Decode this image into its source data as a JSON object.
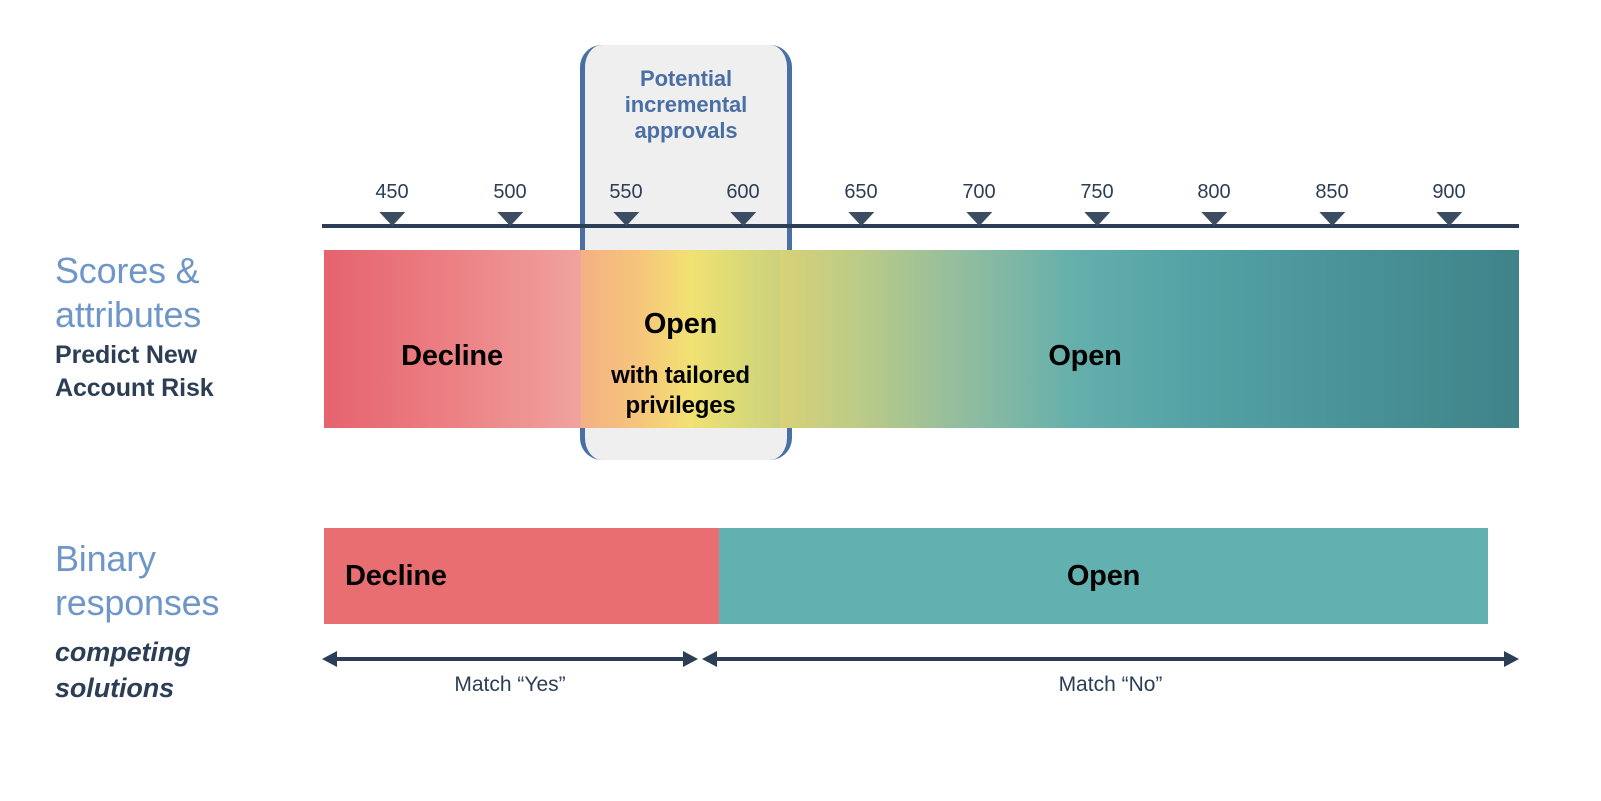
{
  "chart_data": {
    "type": "bar",
    "title": "",
    "xlabel": "",
    "ylabel": "",
    "axis": {
      "ticks": [
        450,
        500,
        550,
        600,
        650,
        700,
        750,
        800,
        850,
        900
      ],
      "tick_labels": [
        "450",
        "500",
        "550",
        "600",
        "650",
        "700",
        "750",
        "800",
        "850",
        "900"
      ],
      "range_min": 430,
      "range_max": 925,
      "grid": false
    },
    "series": [
      {
        "name": "Scores & attributes",
        "type": "gradient-band",
        "segments": [
          {
            "label": "Decline",
            "sublabel": "",
            "from": 430,
            "to": 550,
            "color_start": "#E5636E",
            "color_end": "#F0A39F"
          },
          {
            "label": "Open",
            "sublabel": "with tailored privileges",
            "from": 550,
            "to": 600,
            "color_start": "#F4B183",
            "color_end": "#D6D178"
          },
          {
            "label": "Open",
            "sublabel": "",
            "from": 600,
            "to": 925,
            "color_start": "#D6D178",
            "color_end": "#3F8389"
          }
        ]
      },
      {
        "name": "Binary responses",
        "type": "band",
        "segments": [
          {
            "label": "Decline",
            "from": 430,
            "to": 585,
            "color": "#E86E72"
          },
          {
            "label": "Open",
            "from": 585,
            "to": 925,
            "color": "#63B0B0"
          }
        ]
      }
    ],
    "annotations": [
      {
        "text": "Potential incremental approvals",
        "from": 550,
        "to": 600
      },
      {
        "text": "Match “Yes”",
        "from": 430,
        "to": 585
      },
      {
        "text": "Match “No”",
        "from": 585,
        "to": 925
      }
    ]
  },
  "rows": {
    "scores": {
      "title": "Scores &\nattributes",
      "subtitle": "Predict New\nAccount Risk",
      "segment_left_label": "Decline",
      "segment_mid_label": "Open",
      "segment_mid_sublabel": "with tailored\nprivileges",
      "segment_right_label": "Open"
    },
    "binary": {
      "title": "Binary\nresponses",
      "subtitle": "competing\nsolutions",
      "segment_left_label": "Decline",
      "segment_right_label": "Open"
    }
  },
  "callout": {
    "title": "Potential\nincremental\napprovals"
  },
  "axis": {
    "ticks": [
      {
        "label": "450"
      },
      {
        "label": "500"
      },
      {
        "label": "550"
      },
      {
        "label": "600"
      },
      {
        "label": "650"
      },
      {
        "label": "700"
      },
      {
        "label": "750"
      },
      {
        "label": "800"
      },
      {
        "label": "850"
      },
      {
        "label": "900"
      }
    ]
  },
  "measures": {
    "yes_label": "Match “Yes”",
    "no_label": "Match “No”"
  },
  "colors": {
    "accent_blue": "#6F96C8",
    "callout_blue": "#4A6FA5",
    "dark_navy": "#2C3E56",
    "red": "#E86E72",
    "teal": "#63B0B0",
    "callout_bg": "#EFEFEF"
  }
}
